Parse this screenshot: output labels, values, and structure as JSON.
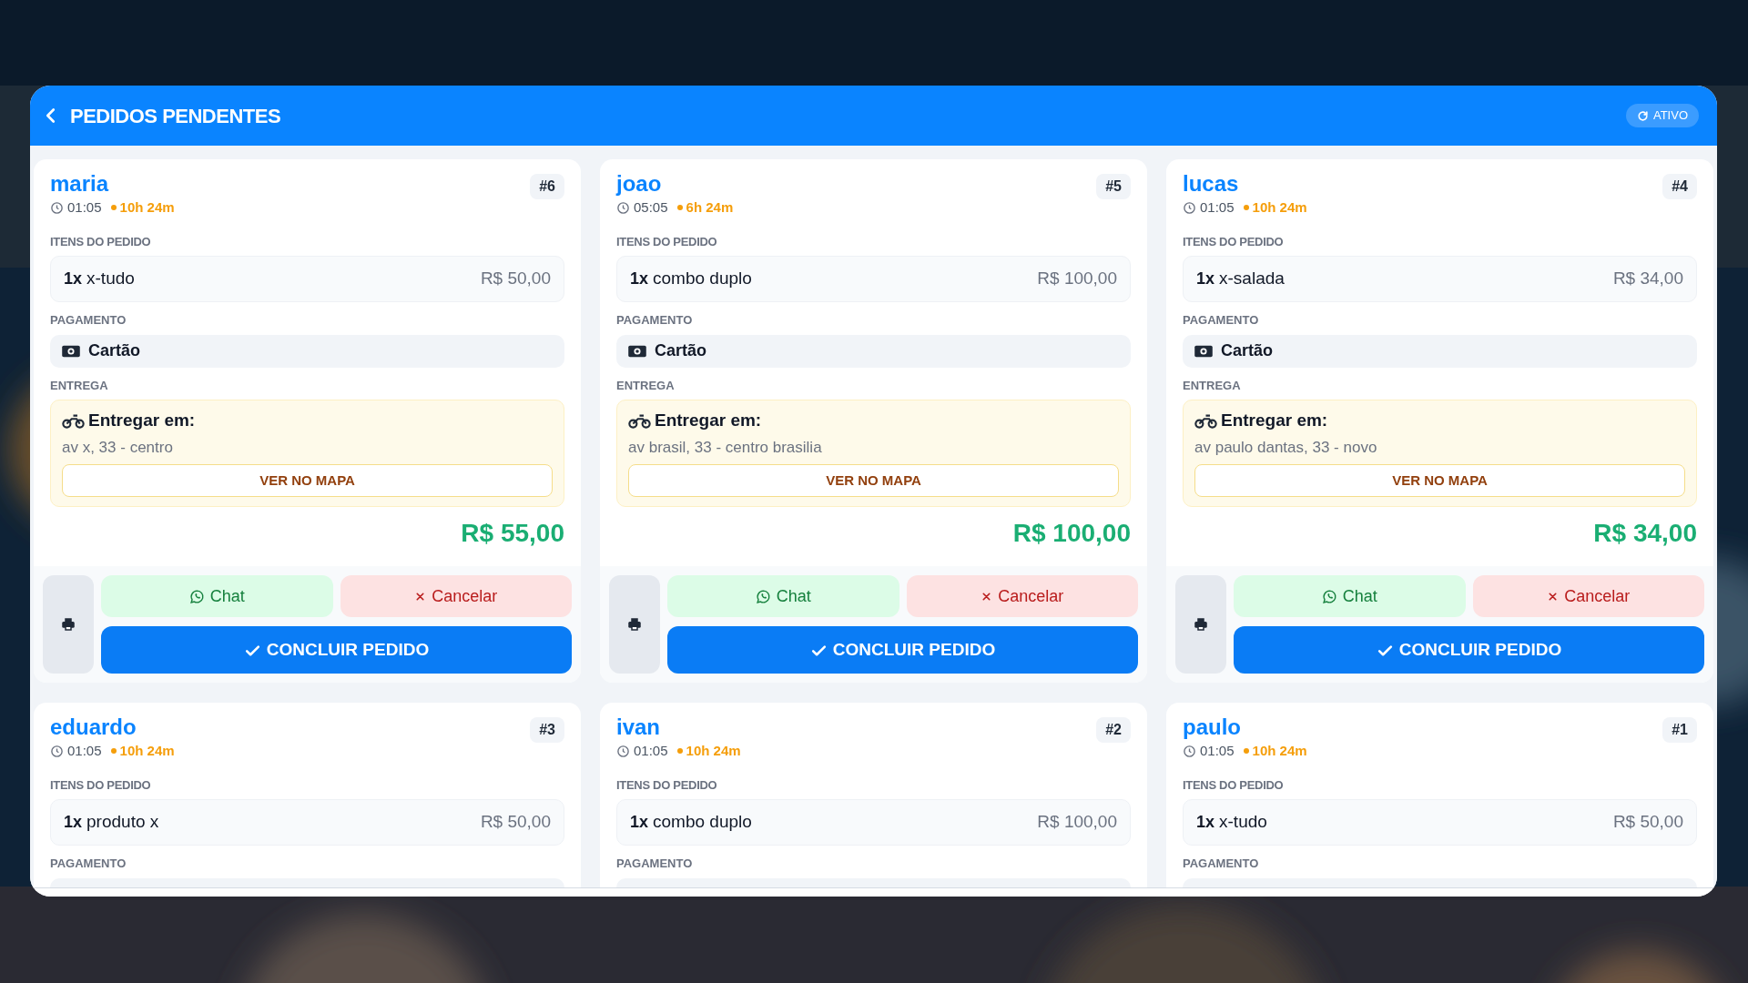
{
  "header": {
    "title": "PEDIDOS PENDENTES",
    "status": "ATIVO"
  },
  "orders": [
    {
      "customer": "maria",
      "number": "#6",
      "time": "01:05",
      "elapsed": "10h 24m",
      "items_label": "ITENS DO PEDIDO",
      "items": [
        {
          "qty": "1x",
          "name": "x-tudo",
          "price": "R$ 50,00"
        }
      ],
      "payment_label": "PAGAMENTO",
      "payment": "Cartão",
      "delivery_label": "ENTREGA",
      "delivery_title": "Entregar em:",
      "address": "av x, 33 - centro",
      "map_button": "VER NO MAPA",
      "total": "R$ 55,00",
      "chat_button": "Chat",
      "cancel_button": "Cancelar",
      "confirm_button": "CONCLUIR PEDIDO"
    },
    {
      "customer": "joao",
      "number": "#5",
      "time": "05:05",
      "elapsed": "6h 24m",
      "items_label": "ITENS DO PEDIDO",
      "items": [
        {
          "qty": "1x",
          "name": "combo duplo",
          "price": "R$ 100,00"
        }
      ],
      "payment_label": "PAGAMENTO",
      "payment": "Cartão",
      "delivery_label": "ENTREGA",
      "delivery_title": "Entregar em:",
      "address": "av brasil, 33 - centro brasilia",
      "map_button": "VER NO MAPA",
      "total": "R$ 100,00",
      "chat_button": "Chat",
      "cancel_button": "Cancelar",
      "confirm_button": "CONCLUIR PEDIDO"
    },
    {
      "customer": "lucas",
      "number": "#4",
      "time": "01:05",
      "elapsed": "10h 24m",
      "items_label": "ITENS DO PEDIDO",
      "items": [
        {
          "qty": "1x",
          "name": "x-salada",
          "price": "R$ 34,00"
        }
      ],
      "payment_label": "PAGAMENTO",
      "payment": "Cartão",
      "delivery_label": "ENTREGA",
      "delivery_title": "Entregar em:",
      "address": "av paulo dantas, 33 - novo",
      "map_button": "VER NO MAPA",
      "total": "R$ 34,00",
      "chat_button": "Chat",
      "cancel_button": "Cancelar",
      "confirm_button": "CONCLUIR PEDIDO"
    },
    {
      "customer": "eduardo",
      "number": "#3",
      "time": "01:05",
      "elapsed": "10h 24m",
      "items_label": "ITENS DO PEDIDO",
      "items": [
        {
          "qty": "1x",
          "name": "produto x",
          "price": "R$ 50,00"
        }
      ],
      "payment_label": "PAGAMENTO"
    },
    {
      "customer": "ivan",
      "number": "#2",
      "time": "01:05",
      "elapsed": "10h 24m",
      "items_label": "ITENS DO PEDIDO",
      "items": [
        {
          "qty": "1x",
          "name": "combo duplo",
          "price": "R$ 100,00"
        }
      ],
      "payment_label": "PAGAMENTO"
    },
    {
      "customer": "paulo",
      "number": "#1",
      "time": "01:05",
      "elapsed": "10h 24m",
      "items_label": "ITENS DO PEDIDO",
      "items": [
        {
          "qty": "1x",
          "name": "x-tudo",
          "price": "R$ 50,00"
        }
      ],
      "payment_label": "PAGAMENTO"
    }
  ]
}
